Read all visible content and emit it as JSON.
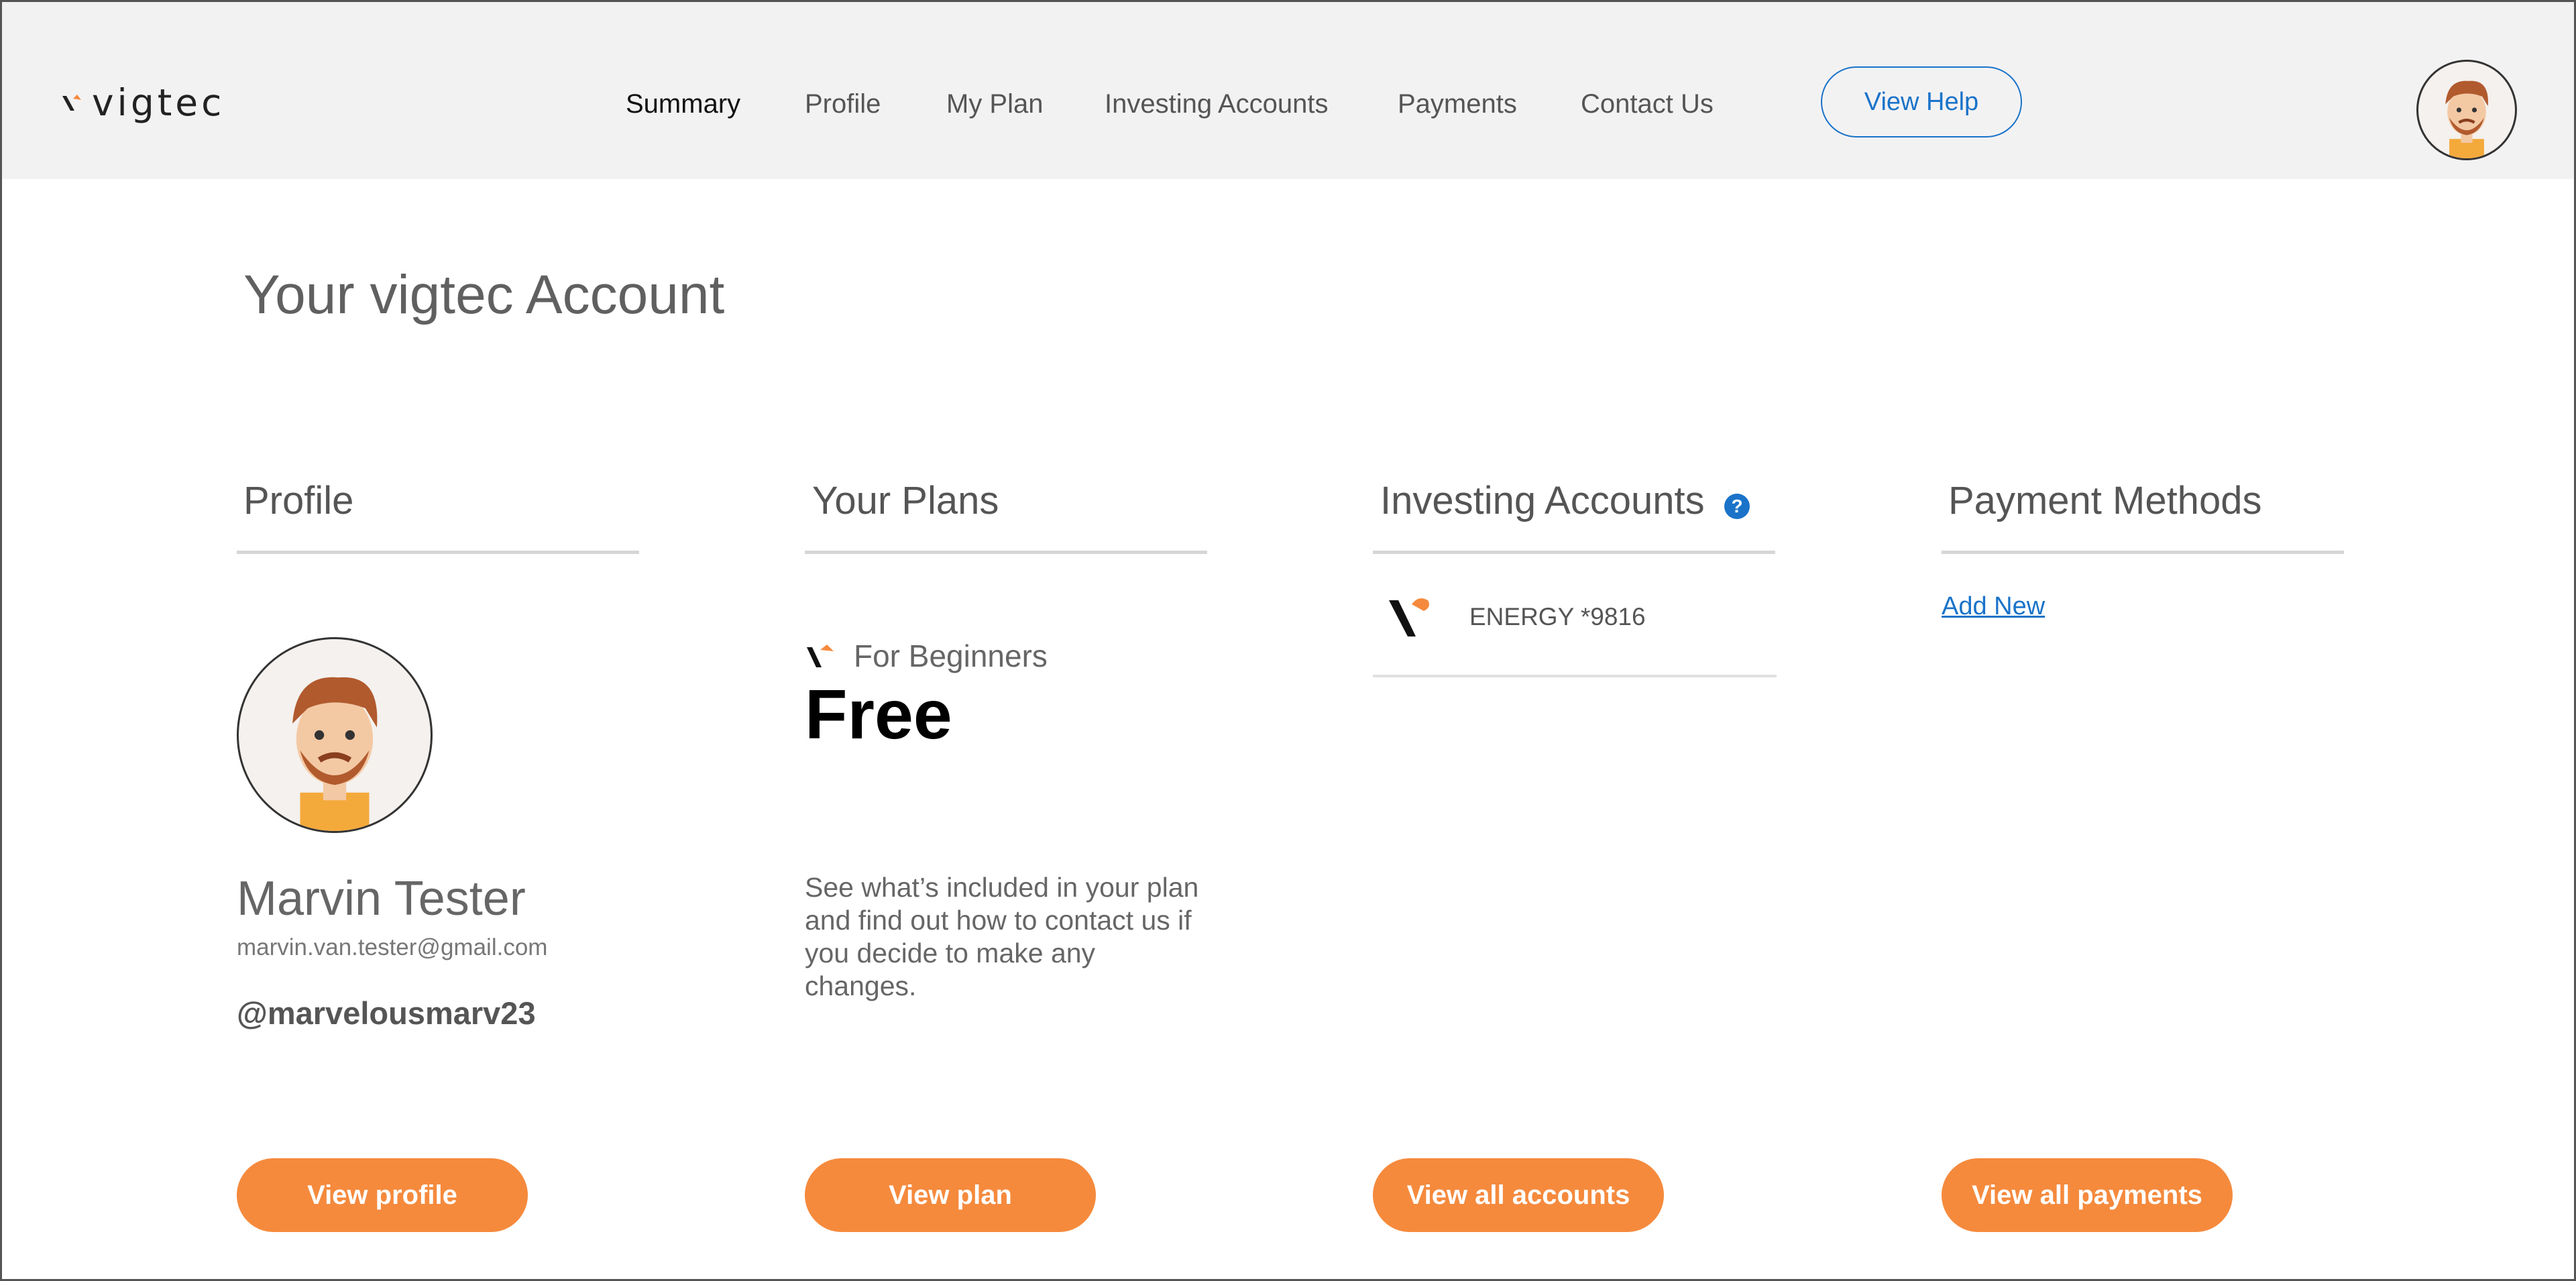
{
  "header": {
    "logo_text": "vigtec",
    "nav": [
      {
        "label": "Summary",
        "active": true
      },
      {
        "label": "Profile",
        "active": false
      },
      {
        "label": "My Plan",
        "active": false
      },
      {
        "label": "Investing Accounts",
        "active": false
      },
      {
        "label": "Payments",
        "active": false
      },
      {
        "label": "Contact Us",
        "active": false
      }
    ],
    "help_button": "View Help"
  },
  "main": {
    "title": "Your vigtec Account",
    "profile": {
      "heading": "Profile",
      "name": "Marvin Tester",
      "email": "marvin.van.tester@gmail.com",
      "handle": "@marvelousmarv23",
      "button": "View profile"
    },
    "plans": {
      "heading": "Your Plans",
      "plan_type": "For Beginners",
      "plan_name": "Free",
      "description": "See what’s included in your plan and find out how to contact us if you decide to make any changes.",
      "button": "View plan"
    },
    "investing": {
      "heading": "Investing Accounts",
      "help_icon": "?",
      "accounts": [
        {
          "name": "ENERGY *9816"
        }
      ],
      "button": "View all accounts"
    },
    "payments": {
      "heading": "Payment Methods",
      "add_new": "Add New",
      "button": "View all payments"
    }
  },
  "colors": {
    "accent_orange": "#f58a3d",
    "link_blue": "#1a73c9",
    "header_bg": "#f3f2f3"
  }
}
